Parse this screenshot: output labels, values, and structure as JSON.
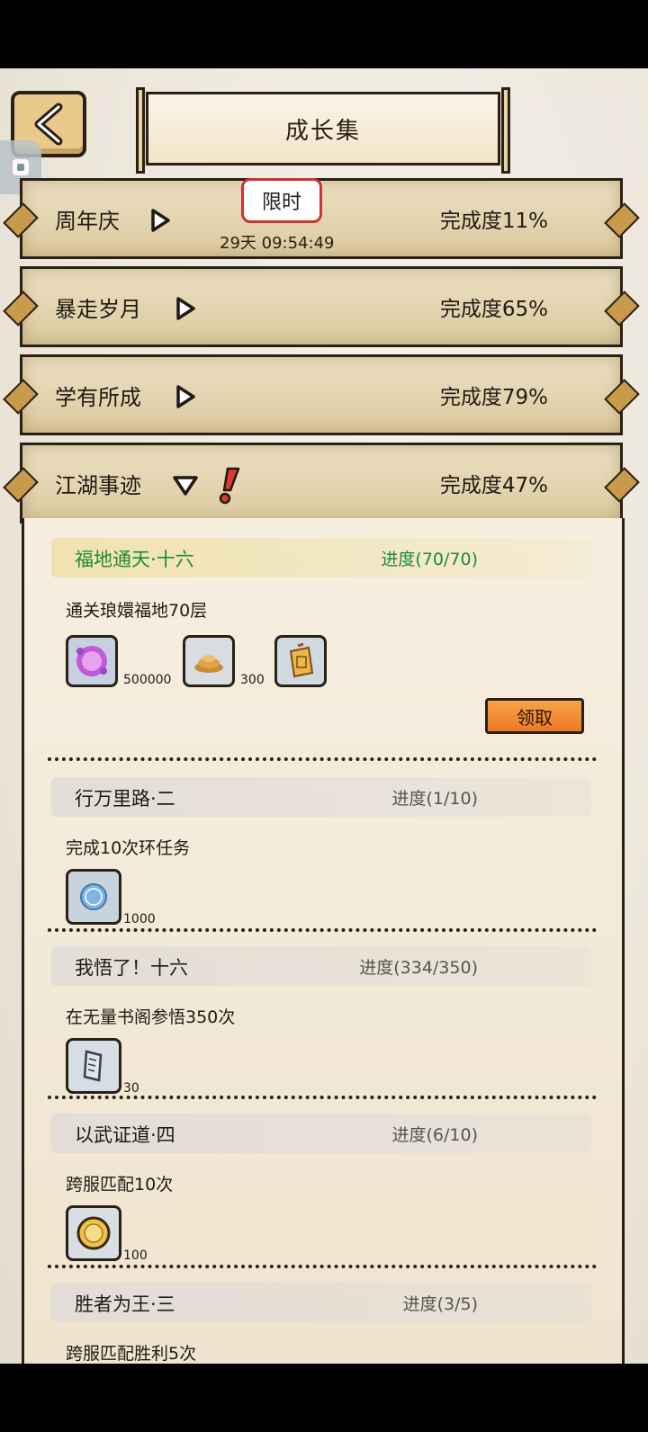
{
  "header": {
    "title": "成长集"
  },
  "categories": [
    {
      "name": "周年庆",
      "completion": "完成度11%",
      "badge": "限时",
      "timer": "29天 09:54:49"
    },
    {
      "name": "暴走岁月",
      "completion": "完成度65%"
    },
    {
      "name": "学有所成",
      "completion": "完成度79%"
    },
    {
      "name": "江湖事迹",
      "completion": "完成度47%"
    }
  ],
  "tasks": [
    {
      "name": "福地通天·十六",
      "progress": "进度(70/70)",
      "desc": "通关琅嬛福地70层",
      "rewards": [
        {
          "icon": "purple-orb-icon",
          "qty": "500000"
        },
        {
          "icon": "gold-pile-icon",
          "qty": "300"
        },
        {
          "icon": "token-icon",
          "qty": ""
        }
      ],
      "claim": "领取"
    },
    {
      "name": "行万里路·二",
      "progress": "进度(1/10)",
      "desc": "完成10次环任务",
      "rewards": [
        {
          "icon": "blue-coin-icon",
          "qty": "1000"
        }
      ]
    },
    {
      "name": "我悟了！十六",
      "progress": "进度(334/350)",
      "desc": "在无量书阁参悟350次",
      "rewards": [
        {
          "icon": "scroll-icon",
          "qty": "30"
        }
      ]
    },
    {
      "name": "以武证道·四",
      "progress": "进度(6/10)",
      "desc": "跨服匹配10次",
      "rewards": [
        {
          "icon": "gold-coin-icon",
          "qty": "100"
        }
      ]
    },
    {
      "name": "胜者为王·三",
      "progress": "进度(3/5)",
      "desc": "跨服匹配胜利5次",
      "rewards": [
        {
          "icon": "mask-icon",
          "qty": ""
        }
      ]
    }
  ]
}
